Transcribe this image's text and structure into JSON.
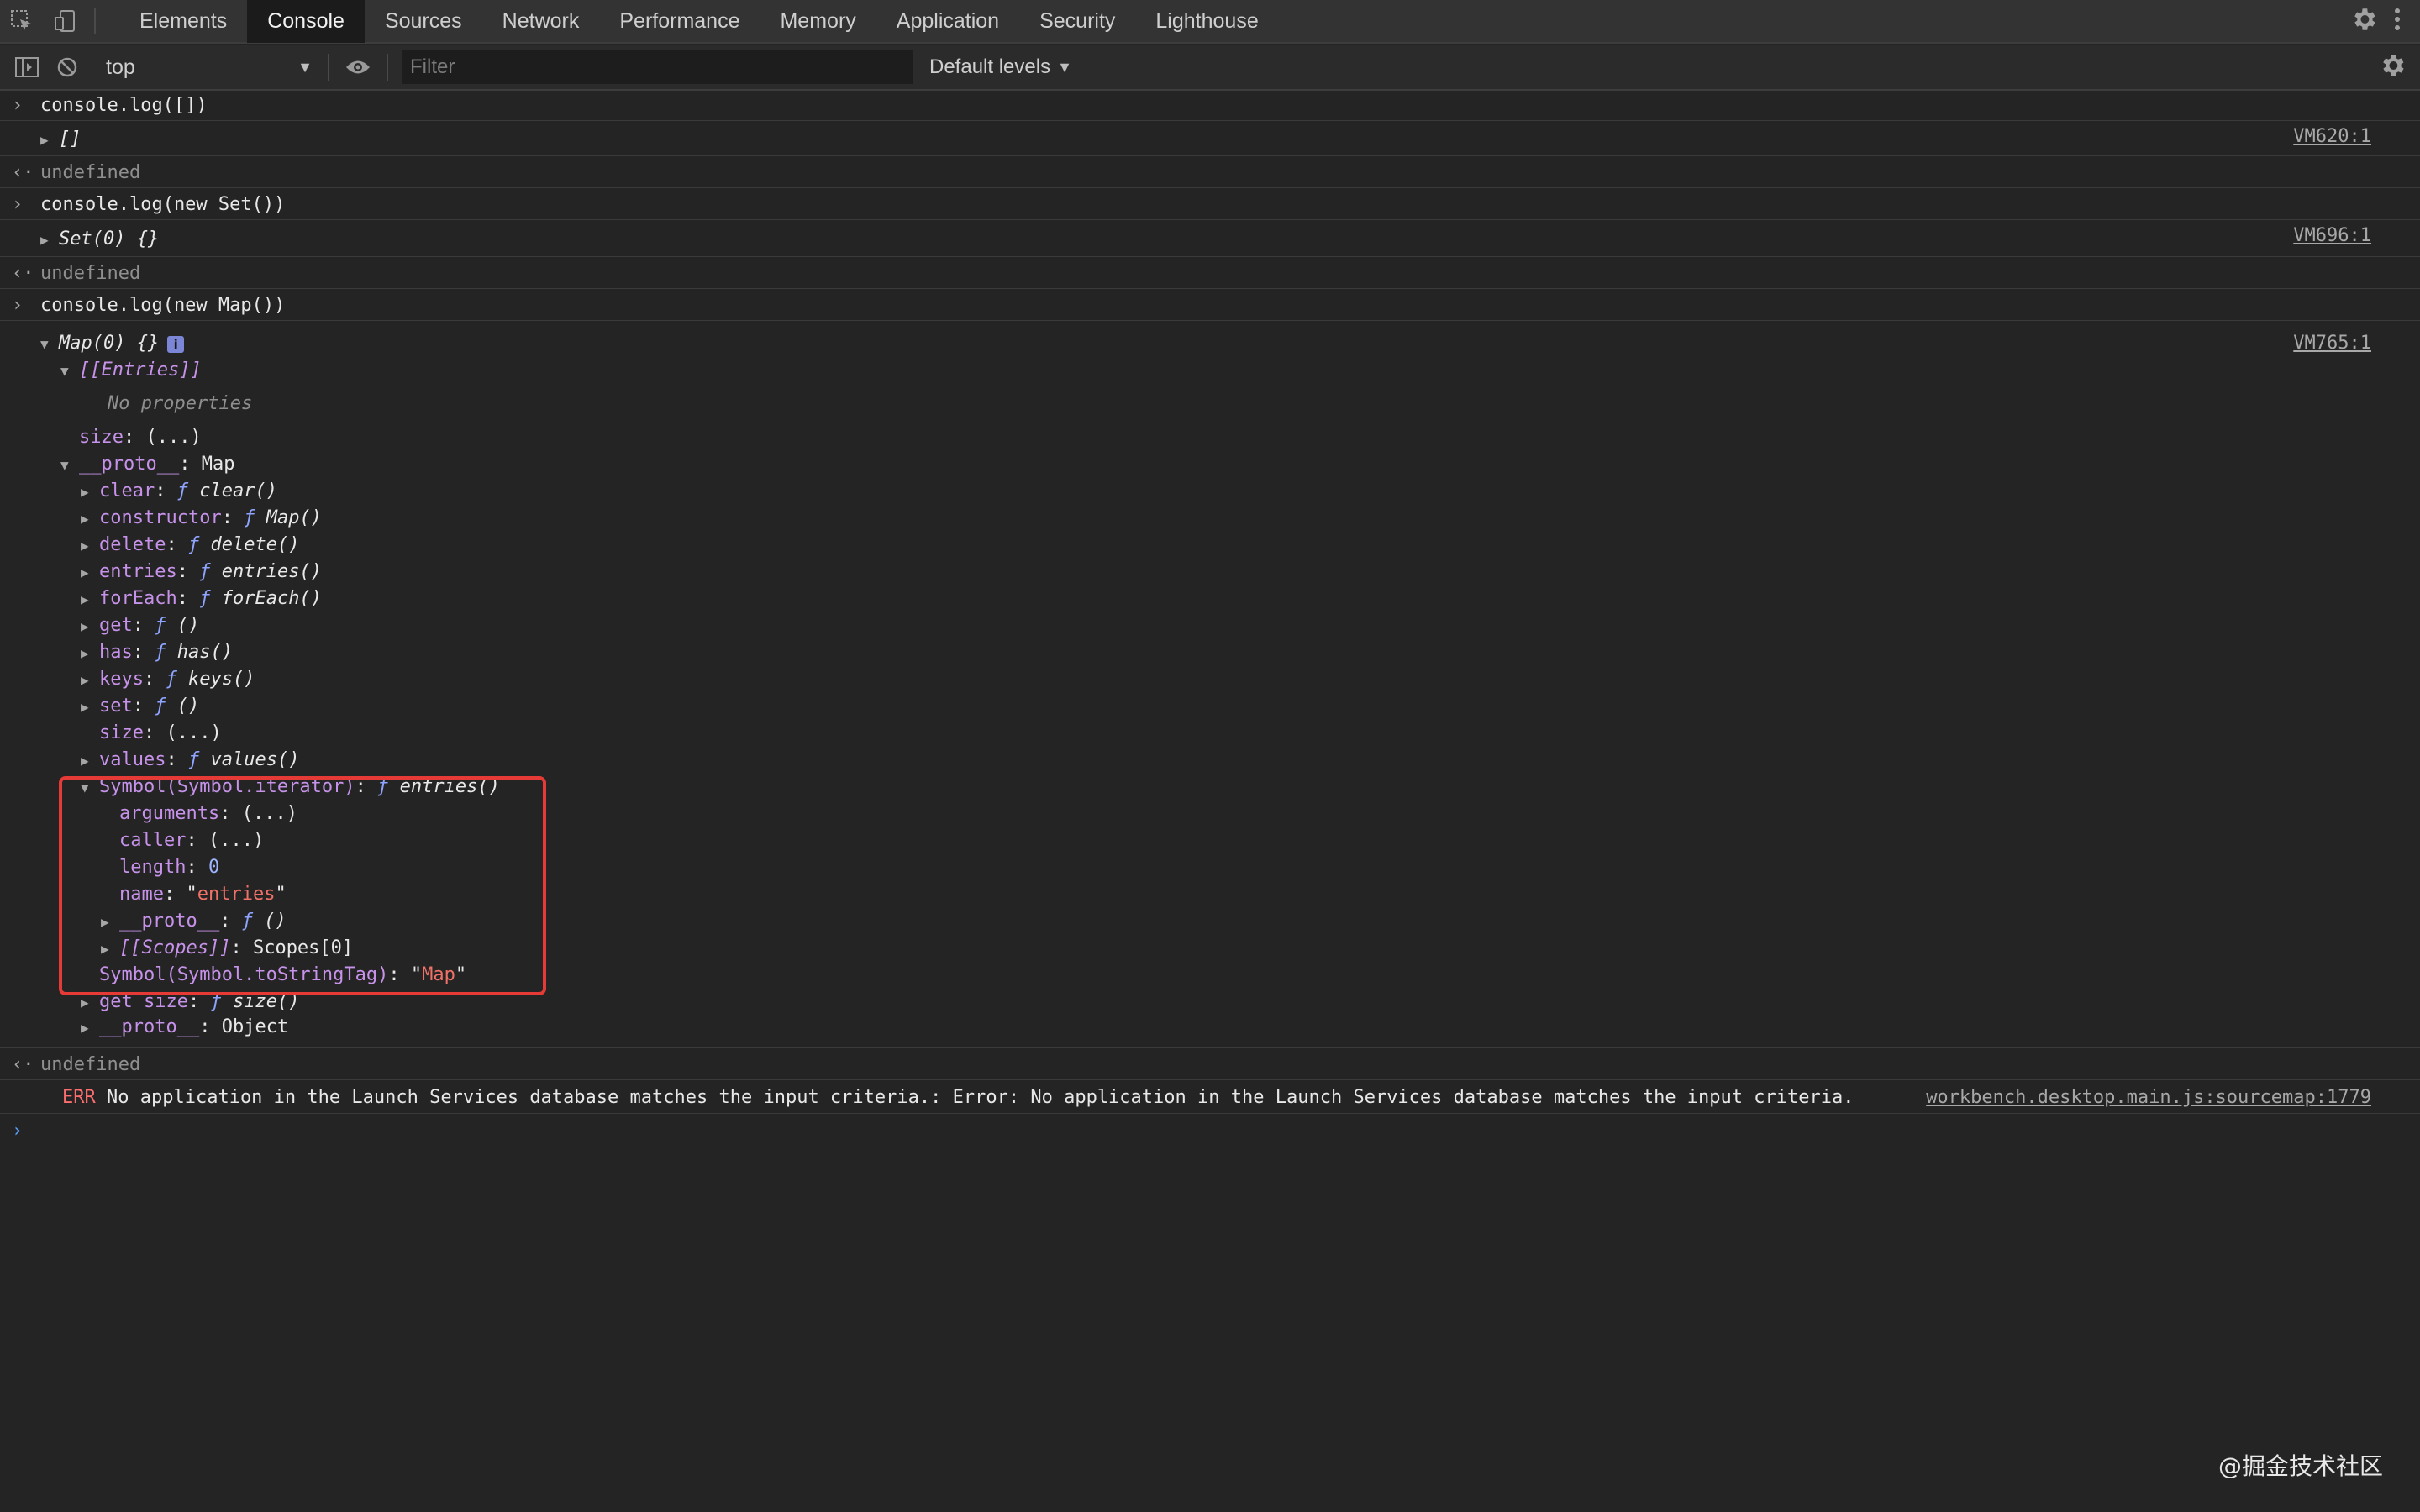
{
  "tabs": [
    "Elements",
    "Console",
    "Sources",
    "Network",
    "Performance",
    "Memory",
    "Application",
    "Security",
    "Lighthouse"
  ],
  "active_tab": "Console",
  "toolbar": {
    "context": "top",
    "filter_placeholder": "Filter",
    "levels": "Default levels"
  },
  "console": {
    "l1_input": "console.log([])",
    "l2_output": "[]",
    "l2_src": "VM620:1",
    "l3_return": "undefined",
    "l4_input": "console.log(new Set())",
    "l5_output": "Set(0) {}",
    "l5_src": "VM696:1",
    "l6_return": "undefined",
    "l7_input": "console.log(new Map())",
    "l8_output": "Map(0) {}",
    "l8_src": "VM765:1",
    "l8_info": "i",
    "entries_key": "[[Entries]]",
    "no_props": "No properties",
    "size_key": "size",
    "size_val": "(...)",
    "proto_key": "__proto__",
    "proto_val": "Map",
    "methods": [
      {
        "key": "clear",
        "fn": "clear()"
      },
      {
        "key": "constructor",
        "fn": "Map()"
      },
      {
        "key": "delete",
        "fn": "delete()"
      },
      {
        "key": "entries",
        "fn": "entries()"
      },
      {
        "key": "forEach",
        "fn": "forEach()"
      },
      {
        "key": "get",
        "fn": "()"
      },
      {
        "key": "has",
        "fn": "has()"
      },
      {
        "key": "keys",
        "fn": "keys()"
      },
      {
        "key": "set",
        "fn": "()"
      }
    ],
    "size2_key": "size",
    "size2_val": "(...)",
    "values_key": "values",
    "values_fn": "values()",
    "iter_key": "Symbol(Symbol.iterator)",
    "iter_fn": "entries()",
    "args_key": "arguments",
    "args_val": "(...)",
    "caller_key": "caller",
    "caller_val": "(...)",
    "length_key": "length",
    "length_val": "0",
    "name_key": "name",
    "name_val": "entries",
    "iproto_key": "__proto__",
    "iproto_fn": "()",
    "scopes_key": "[[Scopes]]",
    "scopes_val": "Scopes[0]",
    "tag_key": "Symbol(Symbol.toStringTag)",
    "tag_val": "Map",
    "getsize_key": "get size",
    "getsize_fn": "size()",
    "oproto_key": "__proto__",
    "oproto_val": "Object",
    "l_return": "undefined",
    "err_tag": "ERR",
    "err_msg": "No application in the Launch Services database matches the input criteria.: Error: No application in the Launch Services database matches the input criteria.",
    "err_src": "workbench.desktop.main.js:sourcemap:1779",
    "prompt": "›"
  },
  "watermark": "@掘金技术社区",
  "colors": {
    "highlight": "#e53a36",
    "key": "#c792ea",
    "string": "#f07167",
    "number": "#9fb4ff"
  }
}
